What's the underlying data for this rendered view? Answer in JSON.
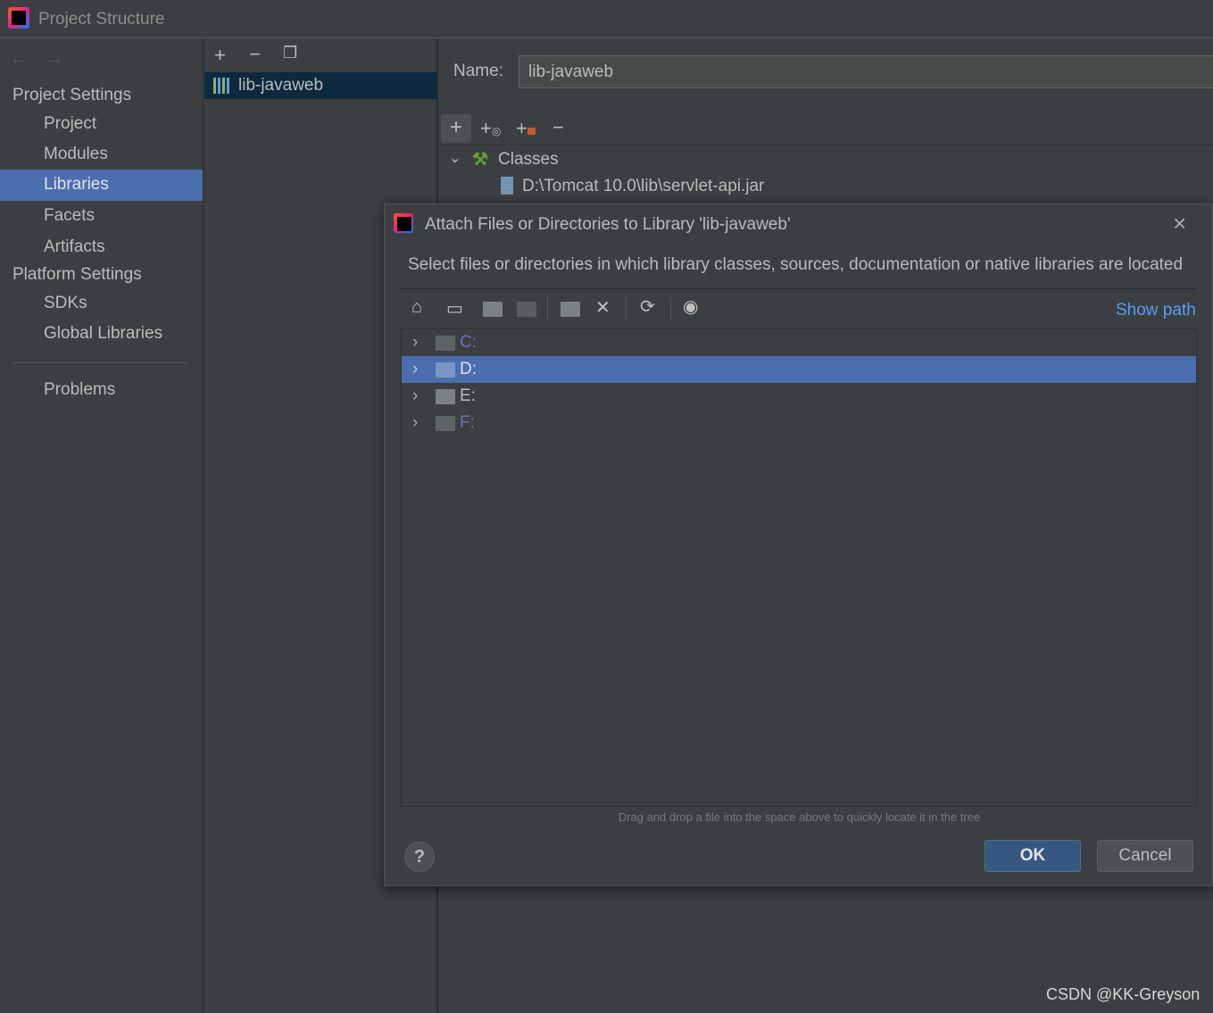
{
  "window": {
    "title": "Project Structure"
  },
  "sidebar": {
    "sections": [
      {
        "label": "Project Settings",
        "items": [
          "Project",
          "Modules",
          "Libraries",
          "Facets",
          "Artifacts"
        ]
      },
      {
        "label": "Platform Settings",
        "items": [
          "SDKs",
          "Global Libraries"
        ]
      }
    ],
    "problems": "Problems",
    "selected": "Libraries"
  },
  "libraries": {
    "items": [
      "lib-javaweb"
    ]
  },
  "detail": {
    "name_label": "Name:",
    "name_value": "lib-javaweb",
    "classes_label": "Classes",
    "class_path": "D:\\Tomcat 10.0\\lib\\servlet-api.jar"
  },
  "dialog": {
    "title": "Attach Files or Directories to Library 'lib-javaweb'",
    "description": "Select files or directories in which library classes, sources, documentation or native libraries are located",
    "show_path": "Show path",
    "tree": [
      {
        "label": "C:",
        "selected": false
      },
      {
        "label": "D:",
        "selected": true
      },
      {
        "label": "E:",
        "selected": false
      },
      {
        "label": "F:",
        "selected": false
      }
    ],
    "hint": "Drag and drop a file into the space above to quickly locate it in the tree",
    "ok": "OK",
    "cancel": "Cancel",
    "help": "?"
  },
  "watermark": "CSDN @KK-Greyson",
  "colors": {
    "selection": "#4b6eaf",
    "accent_link": "#589df6",
    "ok_button": "#365880"
  }
}
